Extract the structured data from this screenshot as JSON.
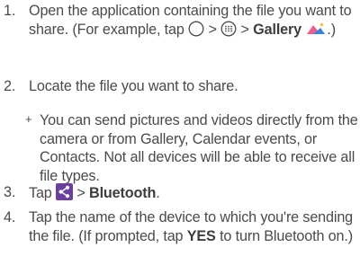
{
  "steps": [
    {
      "num": "1.",
      "text_a": "Open the application containing the file you want to share. (For example, tap",
      "sep1": ">",
      "sep2": ">",
      "bold": "Gallery",
      "tail": ".)"
    },
    {
      "num": "2.",
      "text": "Locate the file you want to share."
    },
    {
      "bullet": "+",
      "text": "You can send pictures and videos directly from the camera or from Gallery, Calendar events, or Contacts. Not all devices will be able to receive all file types."
    },
    {
      "num": "3.",
      "text_a": "Tap",
      "sep": ">",
      "bold": "Bluetooth",
      "tail": "."
    },
    {
      "num": "4.",
      "text_a": "Tap the name of the device to which you're sending the file. (If prompted, tap",
      "bold": "YES",
      "text_b": "to turn Bluetooth on.)"
    }
  ],
  "icons": {
    "home": "home-circle-icon",
    "apps": "apps-grid-icon",
    "gallery": "gallery-icon",
    "share": "share-icon"
  },
  "colors": {
    "text": "#4a4a4a",
    "share_bg": "#6b3fa0",
    "gallery_pink": "#ef5d8c",
    "gallery_blue": "#2f86e0"
  }
}
